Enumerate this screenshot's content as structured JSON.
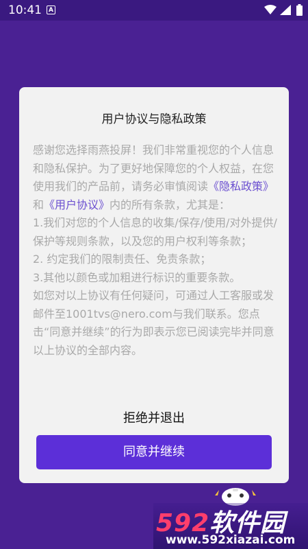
{
  "status_bar": {
    "time": "10:41",
    "notification_glyph": "A",
    "icons": [
      "wifi-icon",
      "signal-icon",
      "battery-icon"
    ]
  },
  "dialog": {
    "title": "用户协议与隐私政策",
    "body": {
      "intro": "感谢您选择雨燕投屏！我们非常重视您的个人信息和隐私保护。为了更好地保障您的个人权益，在您使用我们的产品前，请务必审慎阅读",
      "privacy_link": "《隐私政策》",
      "and": "和",
      "agreement_link": "《用户协议》",
      "after_links": "内的所有条款，尤其是：",
      "item1": " 1.我们对您的个人信息的收集/保存/使用/对外提供/保护等规则条款，以及您的用户权利等条款；",
      "item2": " 2. 约定我们的限制责任、免责条款；",
      "item3": " 3.其他以颜色或加粗进行标识的重要条款。",
      "contact": "如您对以上协议有任何疑问，可通过人工客服或发邮件至1001tvs@nero.com与我们联系。",
      "consent": "您点击“同意并继续”的行为即表示您已阅读完毕并同意以上协议的全部内容。"
    },
    "reject_label": "拒绝并退出",
    "agree_label": "同意并继续"
  },
  "watermark": {
    "number": "592",
    "name": "软件园",
    "url": "www.592xiazai.com"
  },
  "colors": {
    "background": "#4a2193",
    "status_bar": "#3a1980",
    "dialog": "#f2f2f2",
    "body_text": "#a9a9a9",
    "link": "#6b4fd0",
    "agree_button": "#5c2fd8"
  }
}
